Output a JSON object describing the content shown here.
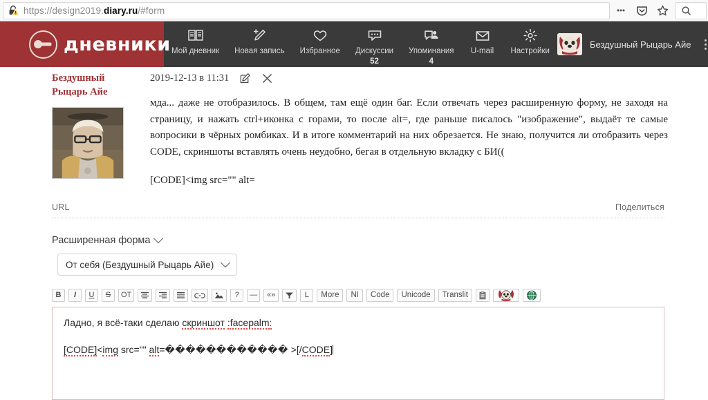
{
  "browser": {
    "url_prefix": "https://design2019.",
    "url_domain": "diary.ru",
    "url_suffix": "/#form",
    "lock_icon": "warning-lock-icon",
    "menu_icon": "page-actions-icon",
    "pocket_icon": "save-to-pocket-icon",
    "bookmark_icon": "bookmark-star-icon",
    "search_icon": "search-icon"
  },
  "header": {
    "brand_text": "дневники",
    "logo_icon": "diary-logo-icon",
    "menu_icon": "hamburger-menu-icon",
    "nav": [
      {
        "label": "Мой дневник",
        "icon": "open-book-icon",
        "count": ""
      },
      {
        "label": "Новая запись",
        "icon": "pencil-new-icon",
        "count": ""
      },
      {
        "label": "Избранное",
        "icon": "heart-icon",
        "count": ""
      },
      {
        "label": "Дискуссии",
        "icon": "chat-bubble-icon",
        "count": "52"
      },
      {
        "label": "Упоминания",
        "icon": "mention-person-icon",
        "count": "4"
      },
      {
        "label": "U-mail",
        "icon": "envelope-icon",
        "count": ""
      },
      {
        "label": "Настройки",
        "icon": "gear-icon",
        "count": ""
      }
    ],
    "user_name": "Бездушный Рыцарь Айе",
    "user_avatar_icon": "user-avatar-dog-icon",
    "more_icon": "kebab-menu-icon"
  },
  "post": {
    "author": "Бездушный Рыцарь Айе",
    "avatar_icon": "post-author-avatar-icon",
    "date": "2019-12-13 в 11:31",
    "edit_icon": "edit-pencil-icon",
    "delete_icon": "close-x-icon",
    "body": "мда... даже не отобразилось. В общем, там ещё один баг. Если отвечать через расширенную форму, не заходя на страницу, и нажать ctrl+иконка с горами, то после alt=, где раньше писалось \"изображение\", выдаёт те самые вопросики в чёрных ромбиках. И в итоге комментарий на них обрезается. Не знаю, получится ли отобразить через CODE, скриншоты вставлять очень неудобно, бегая в отдельную вкладку с БИ((",
    "code_line": "[CODE]<img src=\"\" alt=",
    "url_label": "URL",
    "share_label": "Поделиться"
  },
  "form": {
    "toggle_label": "Расширенная форма",
    "toggle_icon": "chevron-down-icon",
    "author_select_value": "От себя (Бездушный Рыцарь Айе)",
    "author_select_icon": "chevron-down-icon",
    "toolbar": [
      {
        "label": "B",
        "name": "bold-button",
        "style": "b"
      },
      {
        "label": "I",
        "name": "italic-button",
        "style": "i"
      },
      {
        "label": "U",
        "name": "underline-button",
        "style": "u"
      },
      {
        "label": "S",
        "name": "strikethrough-button",
        "style": "s"
      },
      {
        "label": "OT",
        "name": "ot-button",
        "style": ""
      },
      {
        "label": "",
        "name": "align-center-icon",
        "style": "icon-align-center"
      },
      {
        "label": "",
        "name": "align-right-icon",
        "style": "icon-align-right"
      },
      {
        "label": "",
        "name": "align-justify-icon",
        "style": "icon-align-justify"
      },
      {
        "label": "",
        "name": "link-icon",
        "style": "icon-link"
      },
      {
        "label": "",
        "name": "insert-image-icon",
        "style": "icon-image"
      },
      {
        "label": "?",
        "name": "help-button",
        "style": ""
      },
      {
        "label": "—",
        "name": "horizontal-rule-button",
        "style": ""
      },
      {
        "label": "«»",
        "name": "quote-button",
        "style": ""
      },
      {
        "label": "",
        "name": "more-cut-icon",
        "style": "icon-cut"
      },
      {
        "label": "L",
        "name": "list-button",
        "style": ""
      },
      {
        "label": "More",
        "name": "more-button",
        "style": "wide"
      },
      {
        "label": "NI",
        "name": "ni-button",
        "style": "wide"
      },
      {
        "label": "Code",
        "name": "code-button",
        "style": "wide"
      },
      {
        "label": "Unicode",
        "name": "unicode-button",
        "style": "wide"
      },
      {
        "label": "Translit",
        "name": "translit-button",
        "style": "wide"
      },
      {
        "label": "",
        "name": "paste-clipboard-icon",
        "style": "icon-paste"
      },
      {
        "label": "",
        "name": "smiley-dog-icon",
        "style": "icon-smile-dog"
      },
      {
        "label": "",
        "name": "smiley-green-icon",
        "style": "icon-smile-green"
      }
    ],
    "editor_line1_a": "Ладно, я всё-таки сделаю ",
    "editor_line1_b": "скриншот",
    "editor_line1_c": " ",
    "editor_line1_d": ":facepalm:",
    "editor_line2_a": "[CODE]",
    "editor_line2_b": "<",
    "editor_line2_c": "img",
    "editor_line2_d": " src=\"\" ",
    "editor_line2_e": "alt",
    "editor_line2_f": "=",
    "editor_line2_g": "������������",
    "editor_line2_h": " >[/",
    "editor_line2_i": "CODE",
    "editor_line2_j": "]"
  },
  "colors": {
    "brand_red": "#9e3234",
    "nav_dark": "#3a3a3a",
    "author_red": "#a03337",
    "editor_border": "#d9b9b9",
    "spell_underline": "#e04545"
  }
}
